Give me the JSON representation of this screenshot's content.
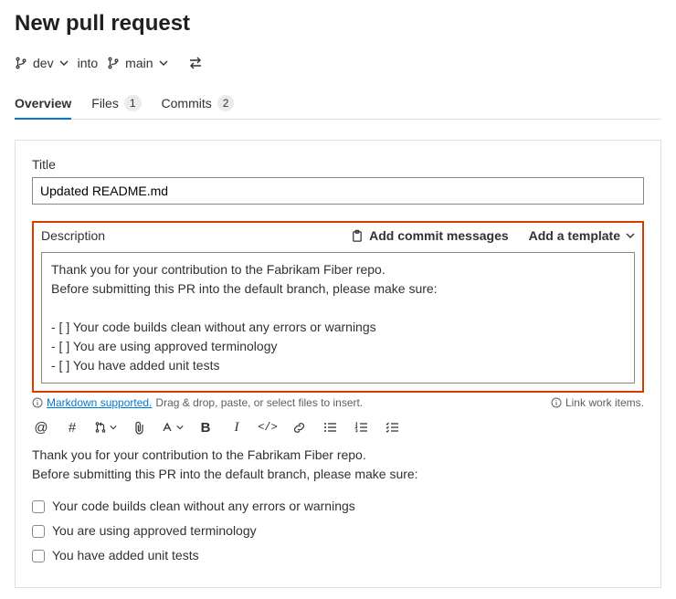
{
  "page_title": "New pull request",
  "branch": {
    "source": "dev",
    "into": "into",
    "target": "main"
  },
  "tabs": {
    "overview": {
      "label": "Overview"
    },
    "files": {
      "label": "Files",
      "count": "1"
    },
    "commits": {
      "label": "Commits",
      "count": "2"
    }
  },
  "form": {
    "title_label": "Title",
    "title_value": "Updated README.md",
    "description_label": "Description",
    "add_commit_messages": "Add commit messages",
    "add_template": "Add a template",
    "description_text": "Thank you for your contribution to the Fabrikam Fiber repo.\nBefore submitting this PR into the default branch, please make sure:\n\n- [ ] Your code builds clean without any errors or warnings\n- [ ] You are using approved terminology\n- [ ] You have added unit tests"
  },
  "helpers": {
    "markdown_supported": "Markdown supported.",
    "drag_drop": "Drag & drop, paste, or select files to insert.",
    "link_work_items": "Link work items."
  },
  "preview": {
    "intro1": "Thank you for your contribution to the Fabrikam Fiber repo.",
    "intro2": "Before submitting this PR into the default branch, please make sure:",
    "checks": [
      "Your code builds clean without any errors or warnings",
      "You are using approved terminology",
      "You have added unit tests"
    ]
  }
}
